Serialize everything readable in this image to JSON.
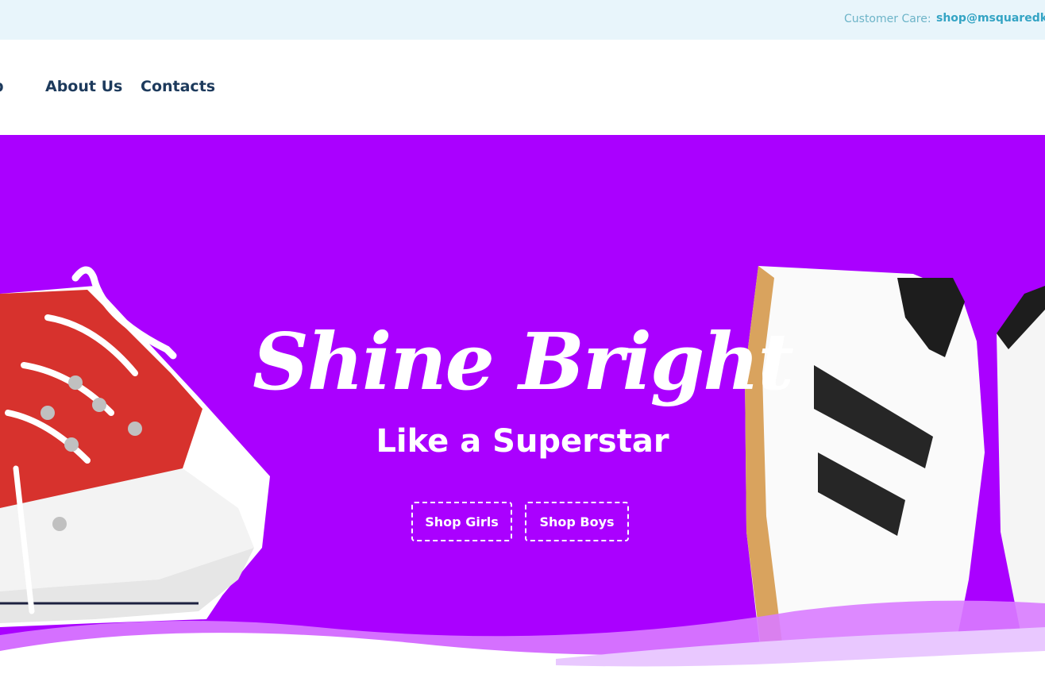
{
  "topbar": {
    "care_label": "Customer Care:",
    "care_email": "shop@msquaredki",
    "background": "#e8f5fb"
  },
  "nav": {
    "items": [
      {
        "label": "op"
      },
      {
        "label": "About Us"
      },
      {
        "label": "Contacts"
      }
    ]
  },
  "hero": {
    "title": "Shine Bright",
    "subtitle": "Like a Superstar",
    "background": "#aa00ff",
    "buttons": [
      {
        "label": "Shop Girls"
      },
      {
        "label": "Shop Boys"
      }
    ]
  }
}
